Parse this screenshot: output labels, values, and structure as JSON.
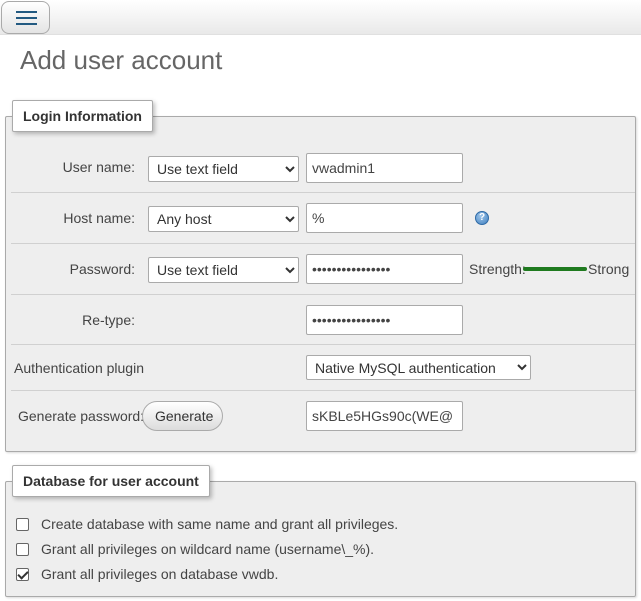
{
  "topbar": {
    "menu_icon": "hamburger-menu-icon"
  },
  "page_title": "Add user account",
  "login": {
    "legend": "Login Information",
    "username": {
      "label": "User name:",
      "mode": "Use text field",
      "value": "vwadmin1"
    },
    "hostname": {
      "label": "Host name:",
      "mode": "Any host",
      "value": "%",
      "help_icon": "help-icon"
    },
    "password": {
      "label": "Password:",
      "mode": "Use text field",
      "value": "••••••••••••••••",
      "strength_label": "Strength:",
      "strength_value": "Strong",
      "strength_color": "#1f7a1f"
    },
    "retype": {
      "label": "Re-type:",
      "value": "••••••••••••••••"
    },
    "auth": {
      "label": "Authentication plugin",
      "value": "Native MySQL authentication"
    },
    "generate": {
      "label": "Generate password:",
      "button": "Generate",
      "value": "sKBLe5HGs90c(WE@"
    }
  },
  "database": {
    "legend": "Database for user account",
    "options": [
      {
        "label": "Create database with same name and grant all privileges.",
        "checked": false
      },
      {
        "label": "Grant all privileges on wildcard name (username\\_%).",
        "checked": false
      },
      {
        "label": "Grant all privileges on database vwdb.",
        "checked": true
      }
    ]
  }
}
